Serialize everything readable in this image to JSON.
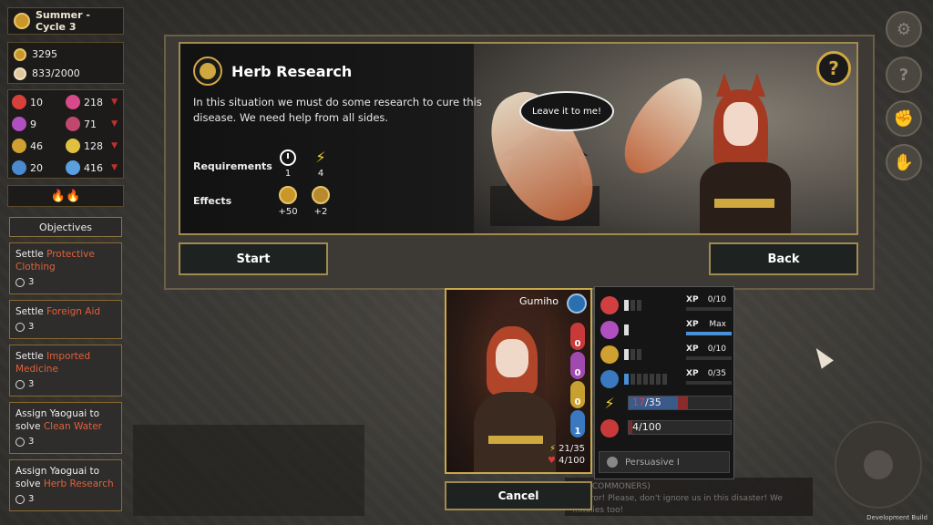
{
  "season": {
    "label": "Summer - Cycle 3"
  },
  "resources": {
    "gold": "3295",
    "population": "833/2000"
  },
  "stats": [
    {
      "value": "10",
      "color": "#d8403a",
      "arrow": false
    },
    {
      "value": "218",
      "color": "#d84a8a",
      "arrow": true
    },
    {
      "value": "9",
      "color": "#b050c0",
      "arrow": false
    },
    {
      "value": "71",
      "color": "#c04870",
      "arrow": true
    },
    {
      "value": "46",
      "color": "#d0a030",
      "arrow": false
    },
    {
      "value": "128",
      "color": "#e0c040",
      "arrow": true
    },
    {
      "value": "20",
      "color": "#4a8ad0",
      "arrow": false
    },
    {
      "value": "416",
      "color": "#5aa0e0",
      "arrow": true
    }
  ],
  "flames": "🔥🔥",
  "objectives": {
    "header": "Objectives",
    "items": [
      {
        "prefix": "Settle ",
        "highlight": "Protective Clothing",
        "count": "3"
      },
      {
        "prefix": "Settle ",
        "highlight": "Foreign Aid",
        "count": "3"
      },
      {
        "prefix": "Settle ",
        "highlight": "Imported Medicine",
        "count": "3"
      },
      {
        "prefix": "Assign Yaoguai to solve ",
        "highlight": "Clean Water",
        "count": "3"
      },
      {
        "prefix": "Assign Yaoguai to solve ",
        "highlight": "Herb Research",
        "count": "3"
      }
    ]
  },
  "dialog": {
    "title": "Herb Research",
    "description": "In this situation we must do some research to cure this disease. We need help from all sides.",
    "requirements_label": "Requirements",
    "effects_label": "Effects",
    "req_time": "1",
    "req_energy": "4",
    "eff_gold": "+50",
    "eff_other": "+2",
    "speech": "Leave it to me!",
    "help": "?"
  },
  "buttons": {
    "start": "Start",
    "back": "Back",
    "cancel": "Cancel"
  },
  "character": {
    "name": "Gumiho",
    "pills": [
      "0",
      "0",
      "0",
      "1"
    ],
    "energy": "21/35",
    "health": "4/100"
  },
  "skills": [
    {
      "xp_label": "XP",
      "xp_value": "0/10"
    },
    {
      "xp_label": "XP",
      "xp_value": "Max"
    },
    {
      "xp_label": "XP",
      "xp_value": "0/10"
    },
    {
      "xp_label": "XP",
      "xp_value": "0/35"
    }
  ],
  "energy_bar": {
    "current": "17",
    "max": "/35"
  },
  "health_bar": {
    "text": "4/100"
  },
  "trait": "Persuasive I",
  "notice": {
    "line1": "...D (COMMONERS)",
    "line2": "...peror! Please, don't ignore us in this disaster! We",
    "line3": "...milies too!"
  },
  "dev_label": "Development Build"
}
